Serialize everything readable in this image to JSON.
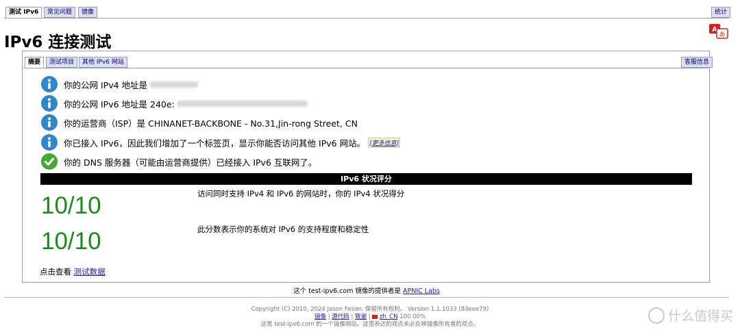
{
  "top_tabs": [
    "测试 IPv6",
    "常见问题",
    "镜像"
  ],
  "stats_tab": "统计",
  "title": "IPv6 连接测试",
  "inner_tabs": [
    "摘要",
    "测试项目",
    "其他 IPv6 网站"
  ],
  "inner_right_tab": "客服信息",
  "rows": [
    {
      "text": "你的公网 IPv4 地址是",
      "icon": "info-icon"
    },
    {
      "text": "你的公网 IPv6 地址是 240e:",
      "icon": "info-icon"
    },
    {
      "text": "你的运营商（ISP）是 CHINANET-BACKBONE - No.31,Jin-rong Street, CN",
      "icon": "info-icon"
    },
    {
      "text": "你已接入 IPv6，因此我们增加了一个标签页，显示你能否访问其他 IPv6 网站。",
      "icon": "info-icon"
    },
    {
      "text": "你的 DNS 服务器（可能由运营商提供）已经接入 IPv6 互联网了。",
      "icon": "check-icon"
    }
  ],
  "more_info": "[更多信息]",
  "score_header": "IPv6 状况评分",
  "scores": [
    {
      "value": "10/10",
      "desc": "访问同时支持 IPv4 和 IPv6 的网站时，你的 IPv4 状况得分"
    },
    {
      "value": "10/10",
      "desc": "此分数表示你的系统对 IPv6 的支持程度和稳定性"
    }
  ],
  "view_prefix": "点击查看",
  "view_link": "测试数据",
  "mirror_prefix": "这个 test-ipv6.com 镜像的提供者是",
  "mirror_link": "APNIC Labs",
  "copyright": "Copyright (C) 2010, 2024 Jason Fesler. 保留所有权利。 Version 1.1.1033 (83eee79)",
  "footer_links": [
    "镜像",
    "源代码",
    "致谢"
  ],
  "locale_link": "zh_CN",
  "locale_pct": "100.00%",
  "disclaimer": "这是 test-ipv6.com 的一个镜像网站。这里表达的观点未必反映镜像所有者的观点。",
  "watermark": "什么值得买",
  "colors": {
    "info": "#2f87c6",
    "check": "#46a636",
    "score": "#1d8a1d"
  }
}
